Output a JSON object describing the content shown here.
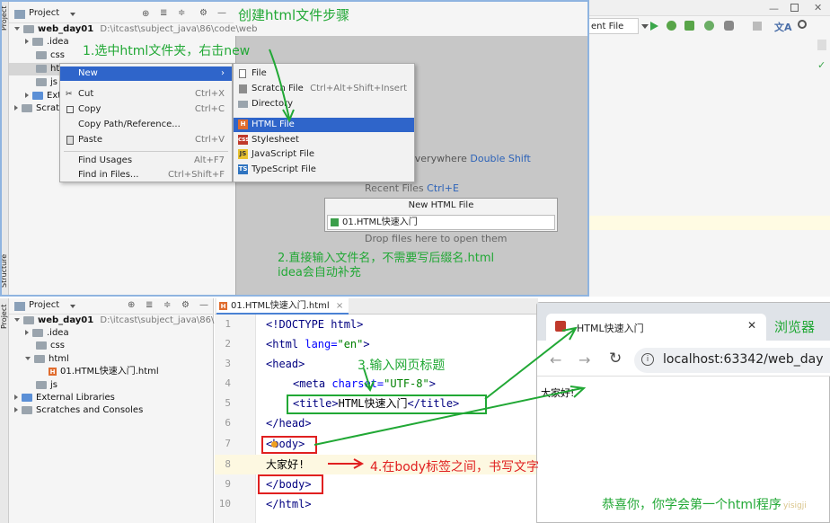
{
  "top": {
    "annotation_title": "创建html文件步骤",
    "annotation_step1": "1.选中html文件夹，右击new",
    "annotation_step2a": "2.直接输入文件名，不需要写后缀名.html",
    "annotation_step2b": "idea会自动补充",
    "project_label": "Project",
    "root_name": "web_day01",
    "root_path": "D:\\itcast\\subject_java\\86\\code\\web",
    "tree": [
      ".idea",
      "css",
      "htm",
      "js",
      "Extern",
      "Scratc"
    ],
    "context_menu": [
      {
        "label": "New",
        "shortcut": ""
      },
      {
        "label": "Cut",
        "shortcut": "Ctrl+X"
      },
      {
        "label": "Copy",
        "shortcut": "Ctrl+C"
      },
      {
        "label": "Copy Path/Reference...",
        "shortcut": ""
      },
      {
        "label": "Paste",
        "shortcut": "Ctrl+V"
      },
      {
        "label": "Find Usages",
        "shortcut": "Alt+F7"
      },
      {
        "label": "Find in Files...",
        "shortcut": "Ctrl+Shift+F"
      }
    ],
    "submenu": [
      {
        "label": "File",
        "shortcut": ""
      },
      {
        "label": "Scratch File",
        "shortcut": "Ctrl+Alt+Shift+Insert"
      },
      {
        "label": "Directory",
        "shortcut": ""
      },
      {
        "label": "HTML File",
        "shortcut": ""
      },
      {
        "label": "Stylesheet",
        "shortcut": ""
      },
      {
        "label": "JavaScript File",
        "shortcut": ""
      },
      {
        "label": "TypeScript File",
        "shortcut": ""
      }
    ],
    "run_config": "ent File",
    "search_hint": "everywhere",
    "search_shortcut": "Double Shift",
    "recent_files": "Recent Files",
    "recent_shortcut": "Ctrl+E",
    "dialog_title": "New HTML File",
    "dialog_value": "01.HTML快速入门",
    "drop_hint": "Drop files here to open them",
    "side_project": "Project",
    "side_structure": "Structure"
  },
  "bottom": {
    "project_label": "Project",
    "root_name": "web_day01",
    "root_path": "D:\\itcast\\subject_java\\86\\code\\web",
    "tree": [
      ".idea",
      "css",
      "html",
      "01.HTML快速入门.html",
      "js",
      "External Libraries",
      "Scratches and Consoles"
    ],
    "editor_tab": "01.HTML快速入门.html",
    "line_numbers": [
      "1",
      "2",
      "3",
      "4",
      "5",
      "6",
      "7",
      "8",
      "9",
      "10"
    ],
    "code": {
      "l1": "<!DOCTYPE html>",
      "l2_tag_open": "<html ",
      "l2_attr": "lang=",
      "l2_val": "\"en\"",
      "l2_close": ">",
      "l3": "<head>",
      "l4_tag": "<meta ",
      "l4_attr": "charset=",
      "l4_val": "\"UTF-8\"",
      "l4_close": ">",
      "l5_open": "<title>",
      "l5_text": "HTML快速入门",
      "l5_close": "</title>",
      "l6": "</head>",
      "l7": "<body>",
      "l8": "大家好!",
      "l9": "</body>",
      "l10": "</html>"
    },
    "annotation_step3": "3.输入网页标题",
    "annotation_step4": "4.在body标签之间，书写文字",
    "annotation_browser": "浏览器",
    "annotation_congrats": "恭喜你，你学会第一个html程序",
    "browser_tab_title": "HTML快速入门",
    "browser_url": "localhost:63342/web_day",
    "browser_content": "大家好!",
    "side_project": "Project",
    "watermark": "yisigji"
  },
  "colors": {
    "accent": "#21a835",
    "selection": "#2f65ca",
    "red": "#e02020"
  }
}
